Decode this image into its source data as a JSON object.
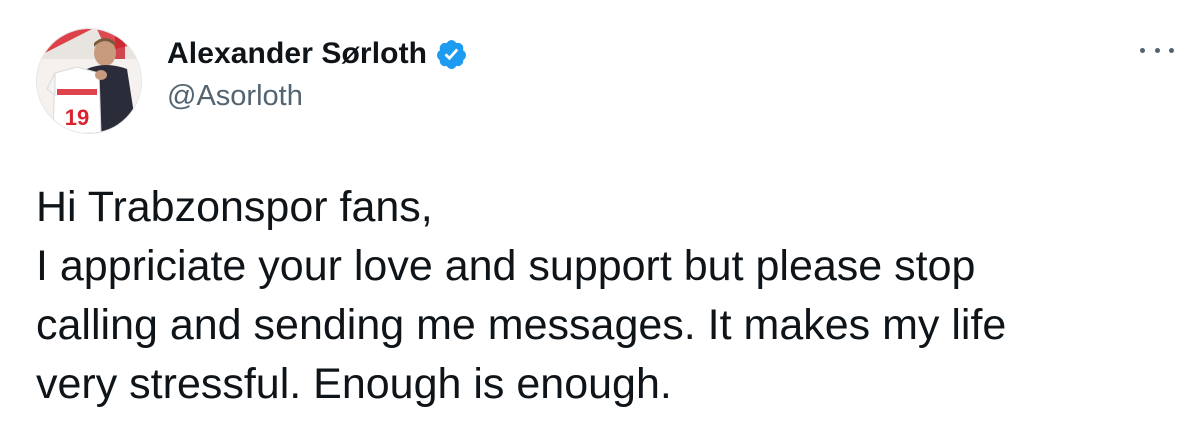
{
  "author": {
    "display_name": "Alexander Sørloth",
    "handle": "@Asorloth",
    "verified": true,
    "verified_icon": "verified-badge-icon",
    "avatar_icon": "profile-photo",
    "avatar_shirt_number": "19"
  },
  "menu": {
    "icon": "more-options-icon"
  },
  "tweet": {
    "lines": [
      "Hi Trabzonspor fans,",
      "I appriciate your love and support but please stop",
      "calling and sending me messages. It makes my life",
      "very stressful. Enough is enough."
    ]
  },
  "colors": {
    "verified_blue": "#1d9bf0",
    "secondary_text": "#536471",
    "primary_text": "#0f1419"
  }
}
